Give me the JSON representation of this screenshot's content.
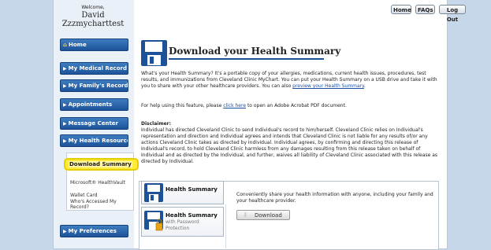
{
  "welcome": {
    "greeting": "Welcome,",
    "first_name": "David",
    "username": "Zzzmycharttest"
  },
  "top_buttons": {
    "home": "Home",
    "faqs": "FAQs",
    "logout": "Log Out"
  },
  "nav": {
    "home": "Home",
    "medical_record": "My Medical Record",
    "family_records": "My Family's Records",
    "appointments": "Appointments",
    "message_center": "Message Center",
    "health_resources": "My Health Resources",
    "preferences": "My Preferences"
  },
  "submenu": {
    "active": "Download Summary",
    "items": [
      "Microsoft® HealthVault",
      "Wallet Card",
      "Who's Accessed My Record?"
    ]
  },
  "page": {
    "title": "Download your Health Summary",
    "intro_1": "What's your Health Summary? It's a portable copy of your allergies, medications, current health issues, procedures, test results, and immunizations from Cleveland Clinic MyChart. You can put your Health Summary on a USB drive and take it with you to share with your other healthcare providers. You can also ",
    "intro_link": "preview your Health Summary",
    "intro_end": ".",
    "help_1": "For help using this feature, please ",
    "help_link": "click here",
    "help_2": " to open an Adobe Acrobat PDF document.",
    "disclaimer_head": "Disclaimer:",
    "disclaimer_text": "Individual has directed Cleveland Clinic to send Individual's record to him/herself. Cleveland Clinic relies on Individual's representation and direction and Individual agrees and intends that Cleveland Clinic is not liable for any results of/or any actions Cleveland Clinic takes as directed by Individual. Individual agrees, by confirming and directing this release of Individual's record, to hold Cleveland Clinic harmless from any damages resulting from this release taken on behalf of Individual and as directed by the Individual, and further, waives all liability of Cleveland Clinic associated with this release as directed by Individual."
  },
  "tabs": {
    "health_summary": "Health Summary",
    "hs_password_title": "Health Summary",
    "hs_password_sub1": "with Password",
    "hs_password_sub2": "Protection"
  },
  "panel": {
    "description": "Conveniently share your health information with anyone, including your family and your healthcare provider.",
    "download_label": "Download"
  },
  "colors": {
    "nav_blue": "#1d5299",
    "accent_yellow": "#ffeb3b",
    "background": "#c7d7ea"
  }
}
